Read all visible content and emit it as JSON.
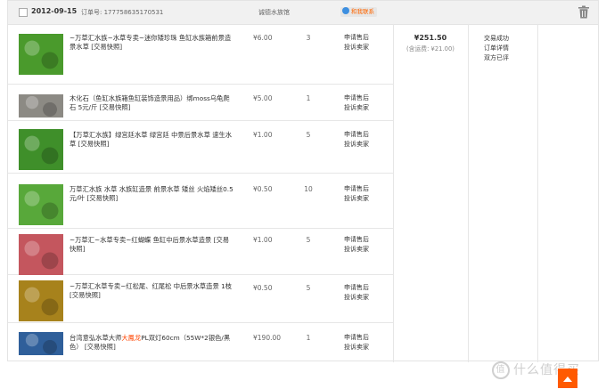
{
  "order": {
    "date": "2012-09-15",
    "order_no": "订单号: 177758635170531",
    "shop": "诚德水族馆",
    "contact_label": "和我联系",
    "total": "¥251.50",
    "shipping": "(含运费: ¥21.00)",
    "status_lines": [
      "交易成功",
      "订单详情",
      "双方已评"
    ]
  },
  "items": [
    {
      "title_pre": "~万草汇水族~水草专卖~迷你矮珍珠 鱼缸水族箱前景造景水草 [交易快照]",
      "title_em": "",
      "title_post": "",
      "price": "¥6.00",
      "qty": "3",
      "svc1": "申请售后",
      "svc2": "投诉卖家",
      "thumb_color": "#4a9a2c"
    },
    {
      "title_pre": "木化石（鱼缸水族箱鱼缸装饰造景用品）绑moss乌龟爬石 5元/斤 [交易快照]",
      "title_em": "",
      "title_post": "",
      "price": "¥5.00",
      "qty": "1",
      "svc1": "申请售后",
      "svc2": "投诉卖家",
      "thumb_color": "#8c8a84"
    },
    {
      "title_pre": "【万草汇水族】绿宫廷水草 绿宫廷 中景后景水草 速生水草 [交易快照]",
      "title_em": "",
      "title_post": "",
      "price": "¥1.00",
      "qty": "5",
      "svc1": "申请售后",
      "svc2": "投诉卖家",
      "thumb_color": "#3f8f2a"
    },
    {
      "title_pre": "万草汇水族 水草 水族缸造景 前景水草 矮丝 火焰矮丝0.5元/叶 [交易快照]",
      "title_em": "",
      "title_post": "",
      "price": "¥0.50",
      "qty": "10",
      "svc1": "申请售后",
      "svc2": "投诉卖家",
      "thumb_color": "#58a83a"
    },
    {
      "title_pre": "~万草汇~水草专卖~红蝴蝶 鱼缸中后景水草造景 [交易快照]",
      "title_em": "",
      "title_post": "",
      "price": "¥1.00",
      "qty": "5",
      "svc1": "申请售后",
      "svc2": "投诉卖家",
      "thumb_color": "#c4565e"
    },
    {
      "title_pre": "~万草汇水草专卖~红松尾、红尾松 中后景水草造景 1枝 [交易快照]",
      "title_em": "",
      "title_post": "",
      "price": "¥0.50",
      "qty": "5",
      "svc1": "申请售后",
      "svc2": "投诉卖家",
      "thumb_color": "#a7821c"
    },
    {
      "title_pre": "台湾意弘水草大师",
      "title_em": "大鳳龙",
      "title_post": "PL双灯60cm（55W*2银色/黑色） [交易快照]",
      "price": "¥190.00",
      "qty": "1",
      "svc1": "申请售后",
      "svc2": "投诉卖家",
      "thumb_color": "#2f5f9a"
    }
  ],
  "watermark": "什么值得买",
  "icons": {
    "trash": "trash-icon",
    "contact": "chat-icon",
    "back_to_top": "arrow-up-icon"
  },
  "colors": {
    "accent": "#ff5a00",
    "highlight": "#ff4400"
  }
}
